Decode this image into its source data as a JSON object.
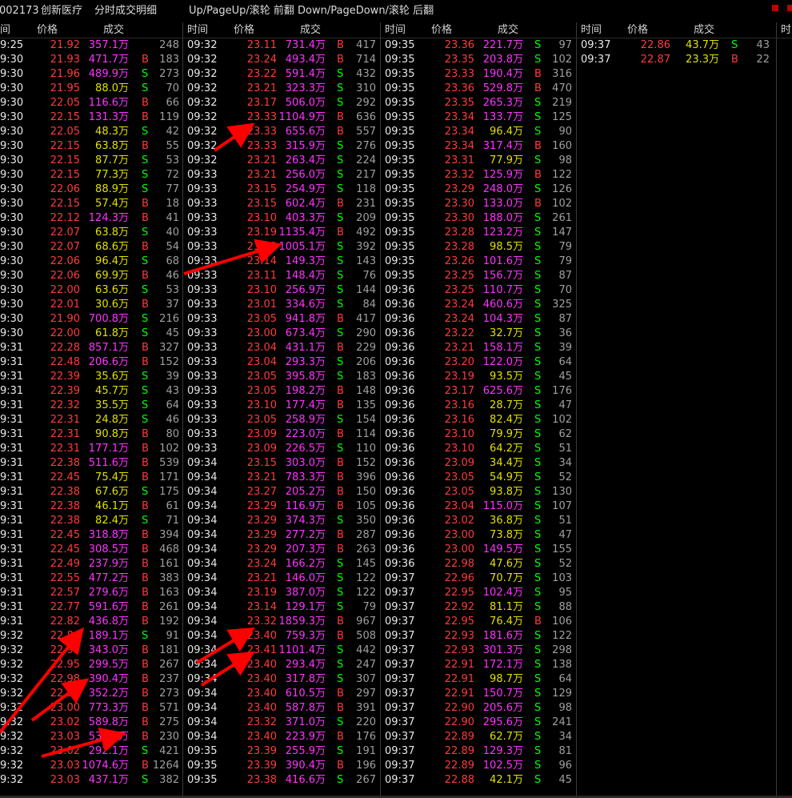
{
  "title": {
    "code": "002173",
    "name": "创新医疗",
    "mode": "分时成交明细",
    "hint": "Up/PageUp/滚轮 前翻 Down/PageDown/滚轮 后翻"
  },
  "headers": {
    "time": "时间",
    "price": "价格",
    "deal": "成交",
    "time_partial": "间",
    "next_col_label": "时"
  },
  "colors": {
    "price": "#ff3b3b",
    "vol_big": "#ff33ff",
    "vol_small": "#e0e000",
    "buy": "#ff3b3b",
    "sell": "#00ff00",
    "annotation": "#ff0000"
  },
  "columns": [
    {
      "rows": [
        [
          "9:25",
          "21.92",
          "357.1万",
          "",
          "248"
        ],
        [
          "9:30",
          "21.93",
          "471.7万",
          "B",
          "183"
        ],
        [
          "9:30",
          "21.96",
          "489.9万",
          "S",
          "273"
        ],
        [
          "9:30",
          "21.95",
          "88.0万",
          "S",
          "70"
        ],
        [
          "9:30",
          "22.05",
          "116.6万",
          "B",
          "66"
        ],
        [
          "9:30",
          "22.15",
          "131.3万",
          "B",
          "119"
        ],
        [
          "9:30",
          "22.05",
          "48.3万",
          "S",
          "42"
        ],
        [
          "9:30",
          "22.15",
          "63.8万",
          "B",
          "55"
        ],
        [
          "9:30",
          "22.15",
          "87.7万",
          "S",
          "53"
        ],
        [
          "9:30",
          "22.15",
          "77.3万",
          "S",
          "72"
        ],
        [
          "9:30",
          "22.06",
          "88.9万",
          "S",
          "77"
        ],
        [
          "9:30",
          "22.15",
          "57.4万",
          "B",
          "18"
        ],
        [
          "9:30",
          "22.12",
          "124.3万",
          "B",
          "41"
        ],
        [
          "9:30",
          "22.07",
          "63.8万",
          "S",
          "40"
        ],
        [
          "9:30",
          "22.07",
          "68.6万",
          "B",
          "54"
        ],
        [
          "9:30",
          "22.06",
          "96.4万",
          "S",
          "68"
        ],
        [
          "9:30",
          "22.06",
          "69.9万",
          "B",
          "46"
        ],
        [
          "9:30",
          "22.00",
          "63.6万",
          "S",
          "53"
        ],
        [
          "9:30",
          "22.01",
          "30.6万",
          "B",
          "37"
        ],
        [
          "9:30",
          "21.90",
          "700.8万",
          "S",
          "216"
        ],
        [
          "9:30",
          "22.00",
          "61.8万",
          "S",
          "45"
        ],
        [
          "9:31",
          "22.28",
          "857.1万",
          "B",
          "327"
        ],
        [
          "9:31",
          "22.48",
          "206.6万",
          "B",
          "152"
        ],
        [
          "9:31",
          "22.39",
          "35.6万",
          "S",
          "39"
        ],
        [
          "9:31",
          "22.39",
          "45.7万",
          "S",
          "43"
        ],
        [
          "9:31",
          "22.32",
          "35.5万",
          "S",
          "64"
        ],
        [
          "9:31",
          "22.31",
          "24.8万",
          "S",
          "46"
        ],
        [
          "9:31",
          "22.31",
          "90.8万",
          "B",
          "80"
        ],
        [
          "9:31",
          "22.31",
          "177.1万",
          "B",
          "102"
        ],
        [
          "9:31",
          "22.38",
          "511.6万",
          "B",
          "539"
        ],
        [
          "9:31",
          "22.45",
          "75.4万",
          "B",
          "171"
        ],
        [
          "9:31",
          "22.38",
          "67.6万",
          "S",
          "175"
        ],
        [
          "9:31",
          "22.38",
          "46.1万",
          "B",
          "61"
        ],
        [
          "9:31",
          "22.38",
          "82.4万",
          "S",
          "71"
        ],
        [
          "9:31",
          "22.45",
          "318.8万",
          "B",
          "394"
        ],
        [
          "9:31",
          "22.45",
          "308.5万",
          "B",
          "468"
        ],
        [
          "9:31",
          "22.49",
          "237.9万",
          "B",
          "161"
        ],
        [
          "9:31",
          "22.55",
          "477.2万",
          "B",
          "383"
        ],
        [
          "9:31",
          "22.57",
          "279.6万",
          "B",
          "163"
        ],
        [
          "9:31",
          "22.77",
          "591.6万",
          "B",
          "261"
        ],
        [
          "9:31",
          "22.82",
          "436.8万",
          "B",
          "192"
        ],
        [
          "9:32",
          "22.84",
          "189.1万",
          "S",
          "91"
        ],
        [
          "9:32",
          "22.93",
          "343.0万",
          "B",
          "181"
        ],
        [
          "9:32",
          "22.95",
          "299.5万",
          "B",
          "267"
        ],
        [
          "9:32",
          "22.98",
          "390.4万",
          "B",
          "237"
        ],
        [
          "9:32",
          "22.99",
          "352.2万",
          "B",
          "273"
        ],
        [
          "9:32",
          "23.00",
          "773.3万",
          "B",
          "571"
        ],
        [
          "9:32",
          "23.02",
          "589.8万",
          "B",
          "275"
        ],
        [
          "9:32",
          "23.03",
          "530.8万",
          "B",
          "230"
        ],
        [
          "9:32",
          "23.02",
          "292.1万",
          "S",
          "421"
        ],
        [
          "9:32",
          "23.03",
          "1074.6万",
          "B",
          "1264"
        ],
        [
          "9:32",
          "23.03",
          "437.1万",
          "S",
          "382"
        ]
      ]
    },
    {
      "rows": [
        [
          "09:32",
          "23.11",
          "731.4万",
          "B",
          "417"
        ],
        [
          "09:32",
          "23.24",
          "493.4万",
          "B",
          "714"
        ],
        [
          "09:32",
          "23.22",
          "591.4万",
          "S",
          "432"
        ],
        [
          "09:32",
          "23.21",
          "323.3万",
          "S",
          "310"
        ],
        [
          "09:32",
          "23.17",
          "506.0万",
          "S",
          "292"
        ],
        [
          "09:32",
          "23.33",
          "1104.9万",
          "B",
          "636"
        ],
        [
          "09:32",
          "23.33",
          "655.6万",
          "B",
          "557"
        ],
        [
          "09:32",
          "23.33",
          "315.9万",
          "S",
          "276"
        ],
        [
          "09:32",
          "23.21",
          "263.4万",
          "S",
          "224"
        ],
        [
          "09:33",
          "23.21",
          "256.0万",
          "S",
          "217"
        ],
        [
          "09:33",
          "23.15",
          "254.9万",
          "S",
          "118"
        ],
        [
          "09:33",
          "23.15",
          "602.4万",
          "B",
          "231"
        ],
        [
          "09:33",
          "23.10",
          "403.3万",
          "S",
          "209"
        ],
        [
          "09:33",
          "23.19",
          "1135.4万",
          "B",
          "492"
        ],
        [
          "09:33",
          "23.19",
          "1005.1万",
          "S",
          "392"
        ],
        [
          "09:33",
          "23.14",
          "149.3万",
          "S",
          "143"
        ],
        [
          "09:33",
          "23.11",
          "148.4万",
          "S",
          "76"
        ],
        [
          "09:33",
          "23.10",
          "256.9万",
          "S",
          "144"
        ],
        [
          "09:33",
          "23.01",
          "334.6万",
          "S",
          "84"
        ],
        [
          "09:33",
          "23.05",
          "941.8万",
          "B",
          "417"
        ],
        [
          "09:33",
          "23.00",
          "673.4万",
          "S",
          "290"
        ],
        [
          "09:33",
          "23.04",
          "431.1万",
          "B",
          "229"
        ],
        [
          "09:33",
          "23.04",
          "293.3万",
          "S",
          "206"
        ],
        [
          "09:33",
          "23.05",
          "395.8万",
          "S",
          "183"
        ],
        [
          "09:33",
          "23.05",
          "198.2万",
          "B",
          "148"
        ],
        [
          "09:33",
          "23.10",
          "177.4万",
          "B",
          "135"
        ],
        [
          "09:33",
          "23.05",
          "258.9万",
          "S",
          "154"
        ],
        [
          "09:33",
          "23.09",
          "223.0万",
          "B",
          "114"
        ],
        [
          "09:33",
          "23.09",
          "226.5万",
          "S",
          "110"
        ],
        [
          "09:34",
          "23.15",
          "303.0万",
          "B",
          "152"
        ],
        [
          "09:34",
          "23.21",
          "783.3万",
          "B",
          "396"
        ],
        [
          "09:34",
          "23.27",
          "205.2万",
          "B",
          "150"
        ],
        [
          "09:34",
          "23.29",
          "116.9万",
          "B",
          "105"
        ],
        [
          "09:34",
          "23.29",
          "374.3万",
          "S",
          "350"
        ],
        [
          "09:34",
          "23.29",
          "277.2万",
          "B",
          "287"
        ],
        [
          "09:34",
          "23.29",
          "207.3万",
          "B",
          "263"
        ],
        [
          "09:34",
          "23.24",
          "166.2万",
          "S",
          "145"
        ],
        [
          "09:34",
          "23.21",
          "146.0万",
          "S",
          "122"
        ],
        [
          "09:34",
          "23.19",
          "387.0万",
          "S",
          "122"
        ],
        [
          "09:34",
          "23.14",
          "129.1万",
          "S",
          "79"
        ],
        [
          "09:34",
          "23.32",
          "1859.3万",
          "B",
          "967"
        ],
        [
          "09:34",
          "23.40",
          "759.3万",
          "B",
          "508"
        ],
        [
          "09:34",
          "23.41",
          "1101.4万",
          "S",
          "442"
        ],
        [
          "09:34",
          "23.40",
          "293.4万",
          "S",
          "247"
        ],
        [
          "09:34",
          "23.40",
          "317.8万",
          "S",
          "307"
        ],
        [
          "09:34",
          "23.40",
          "610.5万",
          "B",
          "297"
        ],
        [
          "09:34",
          "23.40",
          "587.8万",
          "B",
          "391"
        ],
        [
          "09:34",
          "23.32",
          "371.0万",
          "S",
          "220"
        ],
        [
          "09:34",
          "23.40",
          "223.9万",
          "B",
          "176"
        ],
        [
          "09:35",
          "23.39",
          "255.9万",
          "S",
          "191"
        ],
        [
          "09:35",
          "23.39",
          "390.4万",
          "B",
          "196"
        ],
        [
          "09:35",
          "23.38",
          "416.6万",
          "S",
          "267"
        ]
      ]
    },
    {
      "rows": [
        [
          "09:35",
          "23.36",
          "221.7万",
          "S",
          "97"
        ],
        [
          "09:35",
          "23.35",
          "203.8万",
          "S",
          "102"
        ],
        [
          "09:35",
          "23.33",
          "190.4万",
          "B",
          "316"
        ],
        [
          "09:35",
          "23.36",
          "529.8万",
          "B",
          "470"
        ],
        [
          "09:35",
          "23.35",
          "265.3万",
          "S",
          "219"
        ],
        [
          "09:35",
          "23.34",
          "133.7万",
          "S",
          "125"
        ],
        [
          "09:35",
          "23.34",
          "96.4万",
          "S",
          "90"
        ],
        [
          "09:35",
          "23.34",
          "317.4万",
          "B",
          "160"
        ],
        [
          "09:35",
          "23.31",
          "77.9万",
          "S",
          "98"
        ],
        [
          "09:35",
          "23.32",
          "125.9万",
          "B",
          "122"
        ],
        [
          "09:35",
          "23.29",
          "248.0万",
          "S",
          "126"
        ],
        [
          "09:35",
          "23.30",
          "133.0万",
          "B",
          "102"
        ],
        [
          "09:35",
          "23.30",
          "188.0万",
          "S",
          "261"
        ],
        [
          "09:35",
          "23.28",
          "123.2万",
          "S",
          "147"
        ],
        [
          "09:35",
          "23.28",
          "98.5万",
          "S",
          "79"
        ],
        [
          "09:35",
          "23.26",
          "101.6万",
          "S",
          "79"
        ],
        [
          "09:35",
          "23.25",
          "156.7万",
          "S",
          "87"
        ],
        [
          "09:36",
          "23.25",
          "110.7万",
          "S",
          "70"
        ],
        [
          "09:36",
          "23.24",
          "460.6万",
          "S",
          "325"
        ],
        [
          "09:36",
          "23.24",
          "104.3万",
          "S",
          "87"
        ],
        [
          "09:36",
          "23.22",
          "32.7万",
          "S",
          "36"
        ],
        [
          "09:36",
          "23.21",
          "158.1万",
          "S",
          "39"
        ],
        [
          "09:36",
          "23.20",
          "122.0万",
          "S",
          "64"
        ],
        [
          "09:36",
          "23.19",
          "93.5万",
          "S",
          "45"
        ],
        [
          "09:36",
          "23.17",
          "625.6万",
          "S",
          "176"
        ],
        [
          "09:36",
          "23.16",
          "28.7万",
          "S",
          "47"
        ],
        [
          "09:36",
          "23.16",
          "82.4万",
          "S",
          "102"
        ],
        [
          "09:36",
          "23.10",
          "79.9万",
          "S",
          "62"
        ],
        [
          "09:36",
          "23.10",
          "64.2万",
          "S",
          "51"
        ],
        [
          "09:36",
          "23.09",
          "34.4万",
          "S",
          "34"
        ],
        [
          "09:36",
          "23.05",
          "54.9万",
          "S",
          "52"
        ],
        [
          "09:36",
          "23.05",
          "93.8万",
          "S",
          "130"
        ],
        [
          "09:36",
          "23.04",
          "115.0万",
          "S",
          "107"
        ],
        [
          "09:36",
          "23.02",
          "36.8万",
          "S",
          "51"
        ],
        [
          "09:36",
          "23.00",
          "73.8万",
          "S",
          "47"
        ],
        [
          "09:36",
          "23.00",
          "149.5万",
          "S",
          "155"
        ],
        [
          "09:36",
          "22.98",
          "47.6万",
          "S",
          "52"
        ],
        [
          "09:37",
          "22.96",
          "70.7万",
          "S",
          "103"
        ],
        [
          "09:37",
          "22.95",
          "102.4万",
          "S",
          "95"
        ],
        [
          "09:37",
          "22.92",
          "81.1万",
          "S",
          "88"
        ],
        [
          "09:37",
          "22.95",
          "76.4万",
          "B",
          "106"
        ],
        [
          "09:37",
          "22.93",
          "181.6万",
          "S",
          "122"
        ],
        [
          "09:37",
          "22.93",
          "301.3万",
          "S",
          "298"
        ],
        [
          "09:37",
          "22.91",
          "172.1万",
          "S",
          "138"
        ],
        [
          "09:37",
          "22.91",
          "98.7万",
          "S",
          "64"
        ],
        [
          "09:37",
          "22.91",
          "150.7万",
          "S",
          "129"
        ],
        [
          "09:37",
          "22.90",
          "205.6万",
          "S",
          "98"
        ],
        [
          "09:37",
          "22.90",
          "295.6万",
          "S",
          "241"
        ],
        [
          "09:37",
          "22.89",
          "62.7万",
          "S",
          "34"
        ],
        [
          "09:37",
          "22.89",
          "129.3万",
          "S",
          "81"
        ],
        [
          "09:37",
          "22.89",
          "102.5万",
          "S",
          "96"
        ],
        [
          "09:37",
          "22.88",
          "42.1万",
          "S",
          "45"
        ]
      ]
    },
    {
      "rows": [
        [
          "09:37",
          "22.86",
          "43.7万",
          "S",
          "43"
        ],
        [
          "09:37",
          "22.87",
          "23.3万",
          "B",
          "22"
        ]
      ]
    }
  ]
}
